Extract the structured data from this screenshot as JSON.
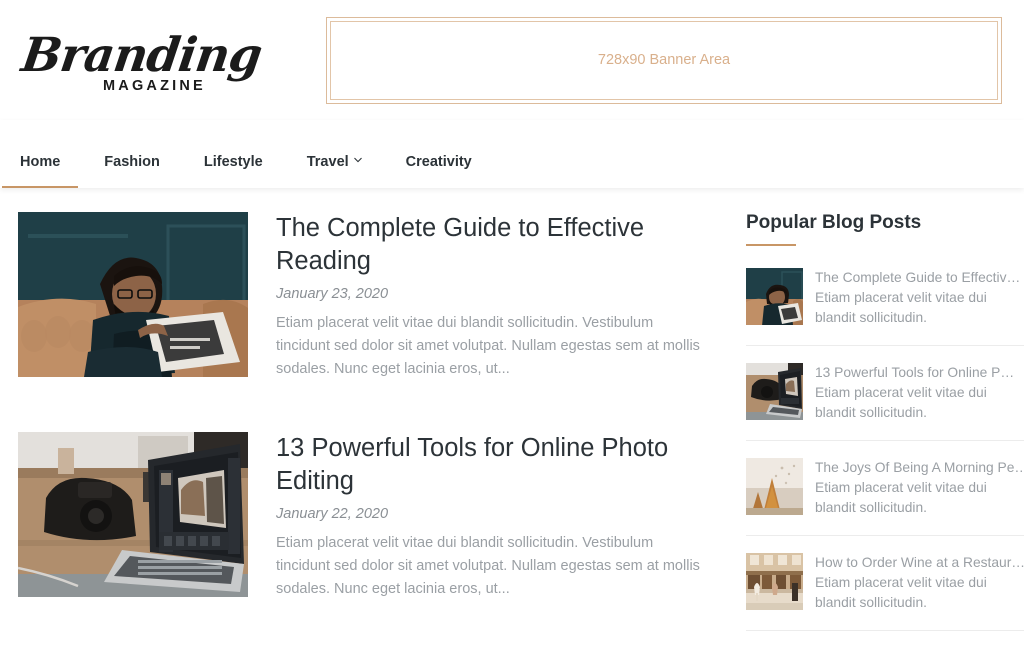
{
  "site": {
    "logo_script": "Branding",
    "logo_sub": "MAGAZINE"
  },
  "banner": {
    "label": "728x90 Banner Area"
  },
  "nav": {
    "items": [
      {
        "label": "Home",
        "active": true,
        "has_dropdown": false
      },
      {
        "label": "Fashion",
        "active": false,
        "has_dropdown": false
      },
      {
        "label": "Lifestyle",
        "active": false,
        "has_dropdown": false
      },
      {
        "label": "Travel",
        "active": false,
        "has_dropdown": true
      },
      {
        "label": "Creativity",
        "active": false,
        "has_dropdown": false
      }
    ]
  },
  "posts": [
    {
      "title": "The Complete Guide to Effective Reading",
      "date": "January 23, 2020",
      "excerpt": "Etiam placerat velit vitae dui blandit sollicitudin. Vestibulum tincidunt sed dolor sit amet volutpat. Nullam egestas sem at mollis sodales. Nunc eget lacinia eros, ut...",
      "image_alt": "man-reading-newspaper-on-sofa"
    },
    {
      "title": "13 Powerful Tools for Online Photo Editing",
      "date": "January 22, 2020",
      "excerpt": "Etiam placerat velit vitae dui blandit sollicitudin. Vestibulum tincidunt sed dolor sit amet volutpat. Nullam egestas sem at mollis sodales. Nunc eget lacinia eros, ut...",
      "image_alt": "laptop-photo-editing-with-camera"
    }
  ],
  "sidebar": {
    "widget_title": "Popular Blog Posts",
    "items": [
      {
        "title": "The Complete Guide to Effectiv…",
        "excerpt": "Etiam placerat velit vitae dui blandit sollicitudin.",
        "image_alt": "man-reading-newspaper-on-sofa"
      },
      {
        "title": "13 Powerful Tools for Online P…",
        "excerpt": "Etiam placerat velit vitae dui blandit sollicitudin.",
        "image_alt": "laptop-photo-editing-with-camera"
      },
      {
        "title": "The Joys Of Being A Morning Pe…",
        "excerpt": "Etiam placerat velit vitae dui blandit sollicitudin.",
        "image_alt": "autumn-trees-morning"
      },
      {
        "title": "How to Order Wine at a Restaur…",
        "excerpt": "Etiam placerat velit vitae dui blandit sollicitudin.",
        "image_alt": "restaurant-interior-wine"
      }
    ]
  },
  "colors": {
    "accent": "#c89666",
    "banner_border": "#dcbb9b",
    "banner_text": "#d9b08c",
    "heading": "#2c3338",
    "body_text": "#9a9fa4",
    "date_text": "#8a8f94"
  }
}
